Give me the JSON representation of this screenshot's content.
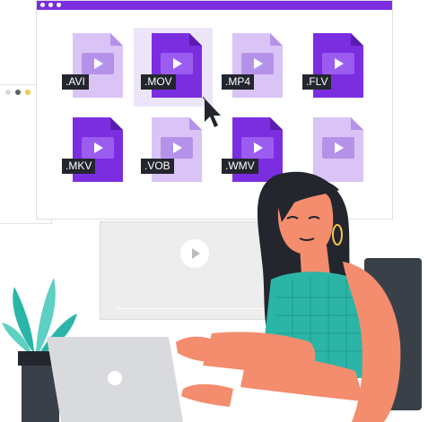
{
  "colors": {
    "purple_dark": "#7b2ee0",
    "purple_light": "#c9a8f2",
    "label_bg": "#23262d",
    "teal": "#2bb5a7",
    "skin": "#f48c6e",
    "hair": "#23262d"
  },
  "file_grid": {
    "files": [
      {
        "label": ".AVI",
        "variant": "light",
        "selected": false
      },
      {
        "label": ".MOV",
        "variant": "dark",
        "selected": true
      },
      {
        "label": ".MP4",
        "variant": "light",
        "selected": false
      },
      {
        "label": ".FLV",
        "variant": "dark",
        "selected": false
      },
      {
        "label": ".MKV",
        "variant": "dark",
        "selected": false
      },
      {
        "label": ".VOB",
        "variant": "light",
        "selected": false
      },
      {
        "label": ".WMV",
        "variant": "dark",
        "selected": false
      },
      {
        "label": "",
        "variant": "light",
        "selected": false
      }
    ]
  },
  "icons": {
    "cursor": "mouse-pointer-icon",
    "video_file": "video-file-icon",
    "play": "play-icon"
  }
}
